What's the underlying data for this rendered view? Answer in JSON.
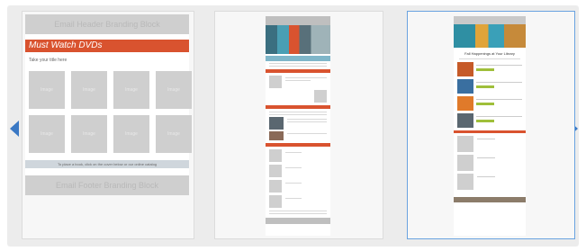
{
  "nav": {
    "prev_icon": "chevron-left-icon",
    "next_icon": "chevron-right-icon",
    "accent": "#3a78c4"
  },
  "template1": {
    "header_text": "Email Header Branding Block",
    "heading": "Must Watch DVDs",
    "subtext": "Take your title here",
    "tile_label": "Image",
    "note": "To place a book, click on the cover below or our online catalog",
    "footer_text": "Email Footer Branding Block"
  },
  "template3": {
    "title": "Fall Happenings at Your Library"
  }
}
